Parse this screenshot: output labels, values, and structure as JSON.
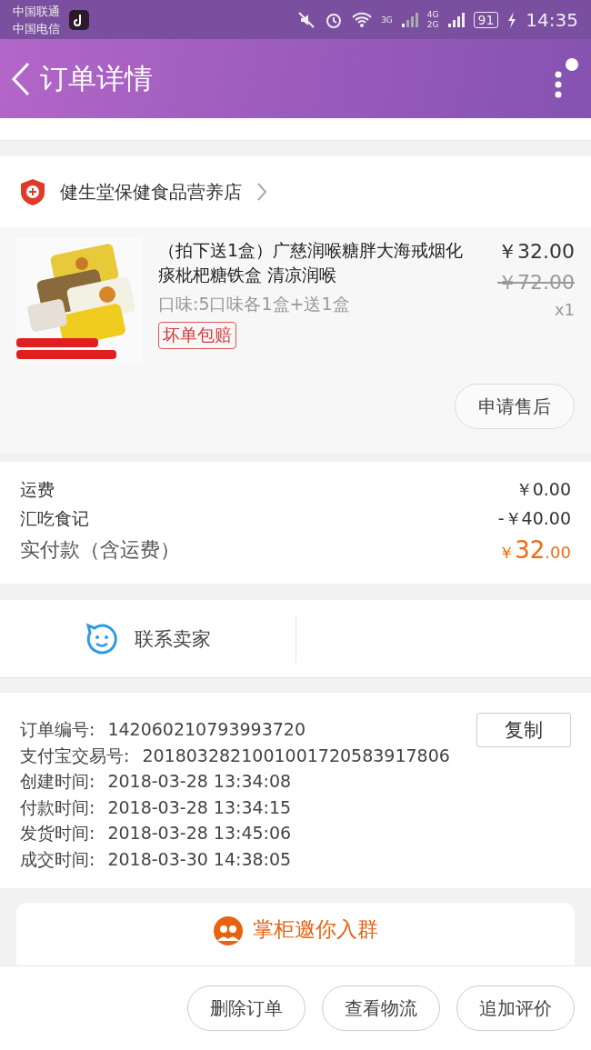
{
  "status_bar": {
    "carriers": [
      "中国联通",
      "中国电信"
    ],
    "net_3g": "3G",
    "net_4g": "4G",
    "net_2g": "2G",
    "battery": "91",
    "time": "14:35"
  },
  "header": {
    "title": "订单详情"
  },
  "shop": {
    "name": "健生堂保健食品营养店"
  },
  "product": {
    "kind": "picture",
    "title": "（拍下送1盒）广慈润喉糖胖大海戒烟化痰枇杷糖铁盒 清凉润喉",
    "spec": "口味:5口味各1盒+送1盒",
    "tag": "坏单包赔",
    "price": "￥32.00",
    "original_price": "￥72.00",
    "quantity": "x1",
    "after_sale": "申请售后"
  },
  "fees": [
    {
      "label": "运费",
      "value": "￥0.00"
    },
    {
      "label": "汇吃食记",
      "value": "-￥40.00"
    }
  ],
  "total": {
    "label": "实付款（含运费）",
    "currency": "￥",
    "integer": "32",
    "decimal": ".00"
  },
  "contact": {
    "label": "联系卖家"
  },
  "order_info": [
    {
      "label": "订单编号:",
      "value": "142060210793993720"
    },
    {
      "label": "支付宝交易号:",
      "value": "2018032821001001720583917806"
    },
    {
      "label": "创建时间:",
      "value": "2018-03-28 13:34:08"
    },
    {
      "label": "付款时间:",
      "value": "2018-03-28 13:34:15"
    },
    {
      "label": "发货时间:",
      "value": "2018-03-28 13:45:06"
    },
    {
      "label": "成交时间:",
      "value": "2018-03-30 14:38:05"
    }
  ],
  "copy_button": "复制",
  "group_invite": "掌柜邀你入群",
  "actions": [
    "删除订单",
    "查看物流",
    "追加评价"
  ]
}
